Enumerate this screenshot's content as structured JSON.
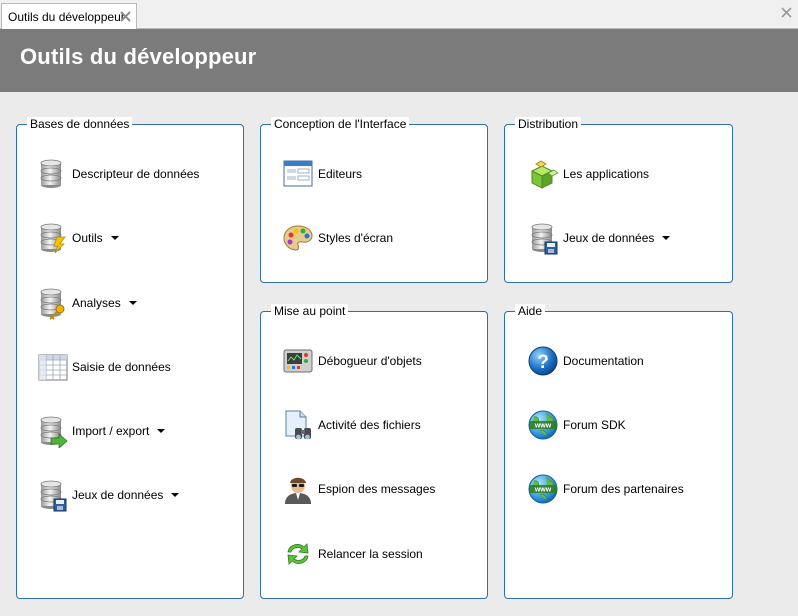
{
  "tab": {
    "label": "Outils du développeur"
  },
  "header": {
    "title": "Outils du développeur"
  },
  "groups": {
    "db": {
      "title": "Bases de données",
      "items": [
        {
          "label": "Descripteur de données",
          "icon": "database-icon"
        },
        {
          "label": "Outils",
          "icon": "database-tools-icon"
        },
        {
          "label": "Analyses",
          "icon": "database-key-icon"
        },
        {
          "label": "Saisie de données",
          "icon": "data-grid-icon"
        },
        {
          "label": "Import / export",
          "icon": "database-export-icon"
        },
        {
          "label": "Jeux de données",
          "icon": "database-save-icon"
        }
      ]
    },
    "ui": {
      "title": "Conception de l'Interface",
      "items": [
        {
          "label": "Editeurs",
          "icon": "window-form-icon"
        },
        {
          "label": "Styles d'écran",
          "icon": "palette-icon"
        }
      ]
    },
    "dist": {
      "title": "Distribution",
      "items": [
        {
          "label": "Les applications",
          "icon": "cubes-icon"
        },
        {
          "label": "Jeux de données",
          "icon": "database-save-icon"
        }
      ]
    },
    "debug": {
      "title": "Mise au point",
      "items": [
        {
          "label": "Débogueur d'objets",
          "icon": "monitor-device-icon"
        },
        {
          "label": "Activité des fichiers",
          "icon": "file-binoculars-icon"
        },
        {
          "label": "Espion des messages",
          "icon": "spy-icon"
        },
        {
          "label": "Relancer la session",
          "icon": "refresh-icon"
        }
      ]
    },
    "help": {
      "title": "Aide",
      "items": [
        {
          "label": "Documentation",
          "icon": "help-icon"
        },
        {
          "label": "Forum SDK",
          "icon": "globe-www-icon"
        },
        {
          "label": "Forum des partenaires",
          "icon": "globe-www-icon"
        }
      ]
    }
  },
  "colors": {
    "header": "#7b7b7b",
    "border": "#2f6fa6",
    "background": "#ebebeb"
  }
}
